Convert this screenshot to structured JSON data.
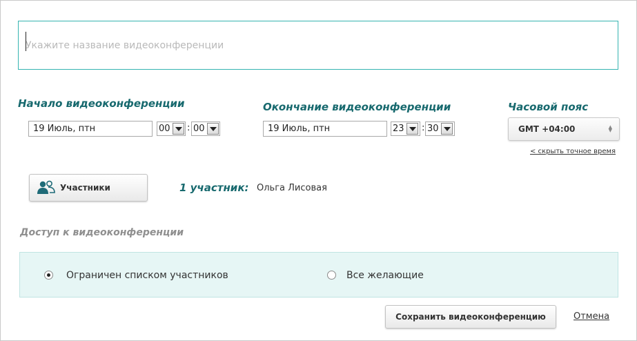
{
  "title_field": {
    "value": "",
    "placeholder": "Укажите название видеоконференции"
  },
  "start": {
    "label": "Начало видеоконференции",
    "date": "19 Июль, птн",
    "hour": "00",
    "minute": "00"
  },
  "end": {
    "label": "Окончание видеоконференции",
    "date": "19 Июль, птн",
    "hour": "23",
    "minute": "30"
  },
  "timezone": {
    "label": "Часовой пояс",
    "value": "GMT +04:00",
    "hide_exact_time_link": "< скрыть точное время"
  },
  "participants": {
    "button_label": "Участники",
    "count_label": "1 участник:",
    "names": "Ольга Лисовая"
  },
  "access": {
    "label": "Доступ к видеоконференции",
    "options": [
      {
        "label": "Ограничен списком участников",
        "selected": true
      },
      {
        "label": "Все желающие",
        "selected": false
      }
    ]
  },
  "footer": {
    "save_label": "Сохранить видеоконференцию",
    "cancel_label": "Отмена"
  },
  "colors": {
    "accent": "#17696e",
    "input_border": "#34b3b0",
    "access_bg": "#e6f6f5"
  },
  "icons": {
    "participants": "users-icon",
    "timezone_spinner": "sort-arrows-icon",
    "dropdown": "chevron-down-icon"
  }
}
